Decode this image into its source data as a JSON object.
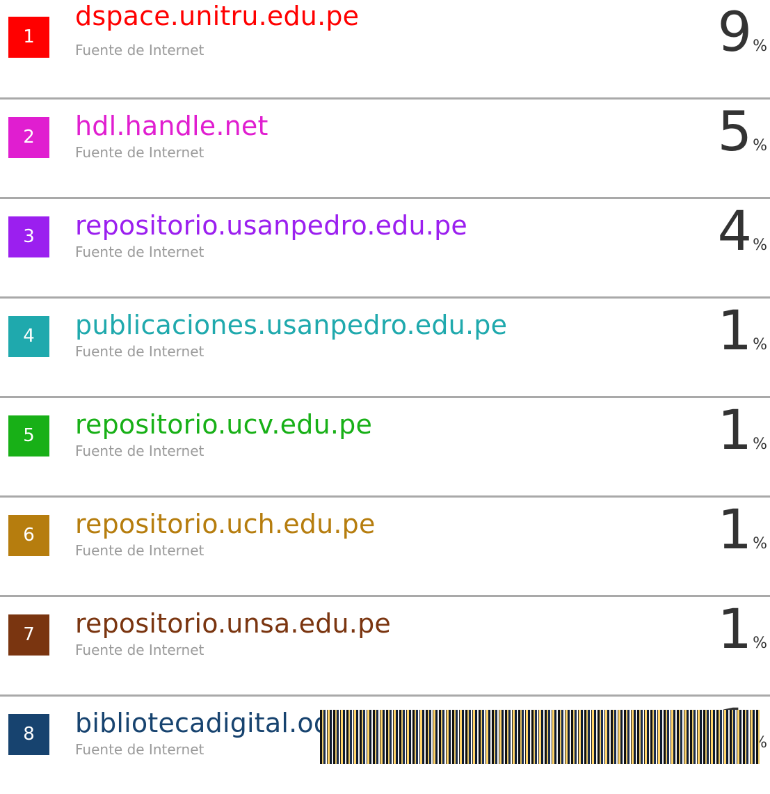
{
  "sources": [
    {
      "n": "1",
      "name": "dspace.unitru.edu.pe",
      "type": "Fuente de Internet",
      "pct": "9",
      "unit": "%",
      "color": "#ff0000"
    },
    {
      "n": "2",
      "name": "hdl.handle.net",
      "type": "Fuente de Internet",
      "pct": "5",
      "unit": "%",
      "color": "#e01ed0"
    },
    {
      "n": "3",
      "name": "repositorio.usanpedro.edu.pe",
      "type": "Fuente de Internet",
      "pct": "4",
      "unit": "%",
      "color": "#9b1fef"
    },
    {
      "n": "4",
      "name": "publicaciones.usanpedro.edu.pe",
      "type": "Fuente de Internet",
      "pct": "1",
      "unit": "%",
      "color": "#1fa9ad"
    },
    {
      "n": "5",
      "name": "repositorio.ucv.edu.pe",
      "type": "Fuente de Internet",
      "pct": "1",
      "unit": "%",
      "color": "#18b017"
    },
    {
      "n": "6",
      "name": "repositorio.uch.edu.pe",
      "type": "Fuente de Internet",
      "pct": "1",
      "unit": "%",
      "color": "#b67d0e"
    },
    {
      "n": "7",
      "name": "repositorio.unsa.edu.pe",
      "type": "Fuente de Internet",
      "pct": "1",
      "unit": "%",
      "color": "#7a3510"
    },
    {
      "n": "8",
      "name": "bibliotecadigital.oducal.com",
      "type": "Fuente de Internet",
      "pct": "1",
      "unit": "%",
      "color": "#17436f"
    }
  ]
}
